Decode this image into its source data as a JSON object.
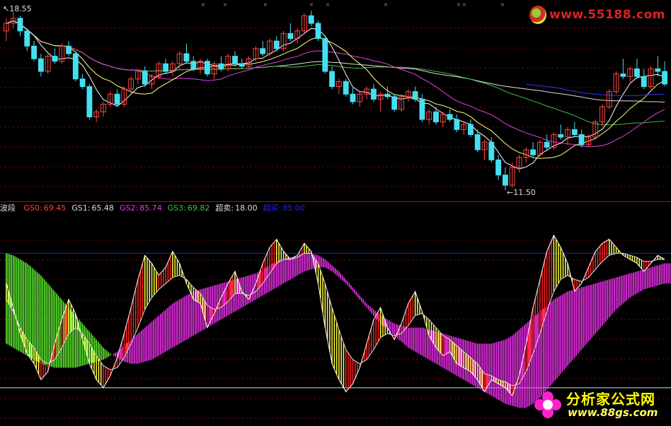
{
  "watermark": {
    "top": "www.55188.com",
    "bottom_title": "分析家公式网",
    "bottom_url": "www.88gs.com"
  },
  "colors": {
    "background": "#000000",
    "up_candle": "#ff4444",
    "down_candle": "#44e0f0",
    "ma_short": "#ffffff",
    "ma_mid": "#ffff80",
    "ma_long1": "#e040e0",
    "ma_long2": "#40c040",
    "ma_long3": "#dddddd",
    "ma_long4": "#3333ff",
    "grid": "#8b0000",
    "divider": "#cc0000",
    "top_marks": "#e040e0"
  },
  "chart_data": {
    "type": "candlestick",
    "price_panel": {
      "high_label": "18.55",
      "low_label": "11.50",
      "ylim": [
        11.2,
        18.8
      ],
      "candles": [
        [
          17.8,
          18.3,
          17.4,
          18.1
        ],
        [
          18.1,
          18.55,
          17.9,
          18.3
        ],
        [
          18.3,
          18.4,
          17.6,
          17.8
        ],
        [
          17.8,
          17.9,
          17.0,
          17.2
        ],
        [
          17.2,
          17.4,
          16.6,
          16.7
        ],
        [
          16.7,
          16.9,
          16.0,
          16.2
        ],
        [
          16.2,
          16.9,
          16.1,
          16.8
        ],
        [
          16.8,
          17.1,
          16.5,
          16.6
        ],
        [
          16.6,
          17.3,
          16.5,
          17.2
        ],
        [
          17.2,
          17.4,
          16.8,
          16.9
        ],
        [
          16.9,
          17.0,
          15.8,
          15.9
        ],
        [
          15.9,
          16.1,
          15.5,
          15.6
        ],
        [
          15.6,
          15.7,
          14.3,
          14.4
        ],
        [
          14.4,
          14.7,
          14.2,
          14.6
        ],
        [
          14.6,
          15.0,
          14.4,
          14.9
        ],
        [
          14.9,
          15.4,
          14.8,
          15.3
        ],
        [
          15.3,
          15.5,
          14.8,
          14.9
        ],
        [
          14.9,
          15.6,
          14.8,
          15.5
        ],
        [
          15.5,
          16.0,
          15.3,
          15.9
        ],
        [
          15.9,
          16.3,
          15.7,
          16.2
        ],
        [
          16.2,
          16.4,
          15.6,
          15.7
        ],
        [
          15.7,
          16.1,
          15.5,
          16.0
        ],
        [
          16.0,
          16.6,
          15.9,
          16.5
        ],
        [
          16.5,
          16.7,
          16.1,
          16.2
        ],
        [
          16.2,
          16.6,
          16.0,
          16.5
        ],
        [
          16.5,
          17.0,
          16.3,
          16.9
        ],
        [
          16.9,
          17.3,
          16.5,
          16.6
        ],
        [
          16.6,
          16.8,
          16.2,
          16.3
        ],
        [
          16.3,
          16.7,
          16.1,
          16.6
        ],
        [
          16.6,
          16.7,
          16.0,
          16.1
        ],
        [
          16.1,
          16.6,
          15.9,
          16.5
        ],
        [
          16.5,
          16.8,
          16.2,
          16.3
        ],
        [
          16.3,
          16.9,
          16.2,
          16.8
        ],
        [
          16.8,
          17.0,
          16.4,
          16.5
        ],
        [
          16.5,
          16.7,
          16.3,
          16.4
        ],
        [
          16.4,
          16.8,
          16.3,
          16.7
        ],
        [
          16.7,
          17.2,
          16.6,
          17.1
        ],
        [
          17.1,
          17.4,
          16.8,
          16.9
        ],
        [
          16.9,
          17.5,
          16.8,
          17.4
        ],
        [
          17.4,
          17.6,
          17.0,
          17.1
        ],
        [
          17.1,
          17.8,
          17.0,
          17.7
        ],
        [
          17.7,
          18.1,
          17.4,
          17.5
        ],
        [
          17.5,
          17.9,
          17.3,
          17.8
        ],
        [
          17.8,
          18.5,
          17.7,
          18.4
        ],
        [
          18.4,
          18.6,
          18.0,
          18.1
        ],
        [
          18.1,
          18.2,
          17.4,
          17.5
        ],
        [
          17.5,
          17.6,
          16.1,
          16.2
        ],
        [
          16.2,
          16.4,
          15.5,
          15.6
        ],
        [
          15.6,
          15.9,
          15.3,
          15.8
        ],
        [
          15.8,
          15.9,
          15.2,
          15.3
        ],
        [
          15.3,
          15.6,
          14.9,
          15.0
        ],
        [
          15.0,
          15.4,
          14.8,
          15.3
        ],
        [
          15.3,
          15.6,
          15.1,
          15.5
        ],
        [
          15.5,
          15.7,
          15.0,
          15.1
        ],
        [
          15.1,
          15.4,
          14.6,
          15.3
        ],
        [
          15.3,
          15.6,
          15.1,
          15.2
        ],
        [
          15.2,
          15.3,
          14.6,
          14.7
        ],
        [
          14.7,
          15.3,
          14.6,
          15.2
        ],
        [
          15.2,
          15.5,
          15.0,
          15.4
        ],
        [
          15.4,
          15.6,
          15.0,
          15.1
        ],
        [
          15.1,
          15.3,
          14.2,
          14.3
        ],
        [
          14.3,
          14.7,
          14.1,
          14.6
        ],
        [
          14.6,
          14.8,
          14.1,
          14.2
        ],
        [
          14.2,
          14.6,
          14.0,
          14.5
        ],
        [
          14.5,
          14.7,
          14.2,
          14.3
        ],
        [
          14.3,
          14.5,
          13.8,
          13.9
        ],
        [
          13.9,
          14.2,
          13.7,
          14.1
        ],
        [
          14.1,
          14.3,
          13.6,
          13.7
        ],
        [
          13.7,
          13.9,
          13.0,
          13.1
        ],
        [
          13.1,
          13.5,
          12.7,
          13.4
        ],
        [
          13.4,
          13.6,
          12.6,
          12.7
        ],
        [
          12.7,
          12.9,
          11.9,
          12.1
        ],
        [
          12.1,
          12.4,
          11.5,
          11.7
        ],
        [
          11.7,
          12.6,
          11.6,
          12.4
        ],
        [
          12.4,
          12.9,
          12.2,
          12.8
        ],
        [
          12.8,
          13.2,
          12.6,
          13.1
        ],
        [
          13.1,
          13.4,
          12.8,
          12.9
        ],
        [
          12.9,
          13.5,
          12.8,
          13.4
        ],
        [
          13.4,
          13.7,
          13.1,
          13.2
        ],
        [
          13.2,
          13.8,
          13.1,
          13.7
        ],
        [
          13.7,
          14.1,
          13.5,
          13.6
        ],
        [
          13.6,
          14.0,
          13.3,
          13.9
        ],
        [
          13.9,
          14.2,
          13.6,
          13.7
        ],
        [
          13.7,
          13.9,
          13.2,
          13.3
        ],
        [
          13.3,
          13.7,
          13.2,
          13.6
        ],
        [
          13.6,
          14.3,
          13.5,
          14.2
        ],
        [
          14.2,
          14.9,
          14.0,
          14.8
        ],
        [
          14.8,
          15.5,
          14.7,
          15.4
        ],
        [
          15.4,
          16.2,
          15.3,
          16.1
        ],
        [
          16.1,
          16.7,
          15.9,
          16.0
        ],
        [
          16.0,
          16.4,
          15.7,
          16.3
        ],
        [
          16.3,
          16.7,
          15.9,
          16.0
        ],
        [
          16.0,
          16.3,
          15.5,
          15.6
        ],
        [
          15.6,
          16.4,
          15.5,
          16.3
        ],
        [
          16.3,
          16.8,
          16.0,
          16.2
        ],
        [
          16.2,
          16.6,
          15.6,
          15.7
        ]
      ]
    },
    "indicator_panel": {
      "name": "波段",
      "items": [
        {
          "key": "GS0",
          "value": "69.45",
          "color": "#ff4040"
        },
        {
          "key": "GS1",
          "value": "65.48",
          "color": "#dddddd"
        },
        {
          "key": "GS2",
          "value": "85.74",
          "color": "#e040e0"
        },
        {
          "key": "GS3",
          "value": "69.82",
          "color": "#40c040"
        },
        {
          "key": "超卖",
          "value": "18.00",
          "color": "#dddddd"
        },
        {
          "key": "超买",
          "value": "85.00",
          "color": "#2020ff"
        }
      ],
      "ylim": [
        0,
        100
      ],
      "overbought": 85,
      "oversold": 18,
      "gs0": [
        70,
        58,
        45,
        35,
        30,
        22,
        26,
        40,
        52,
        62,
        55,
        42,
        30,
        22,
        18,
        24,
        33,
        45,
        58,
        72,
        84,
        80,
        74,
        78,
        86,
        80,
        70,
        62,
        60,
        48,
        55,
        63,
        70,
        76,
        66,
        62,
        70,
        80,
        88,
        92,
        86,
        82,
        84,
        90,
        86,
        70,
        48,
        30,
        22,
        16,
        20,
        28,
        40,
        52,
        58,
        48,
        42,
        50,
        60,
        66,
        56,
        44,
        38,
        34,
        36,
        30,
        28,
        26,
        22,
        16,
        22,
        20,
        18,
        14,
        24,
        40,
        58,
        72,
        86,
        94,
        88,
        80,
        66,
        70,
        78,
        86,
        90,
        92,
        88,
        84,
        82,
        80,
        76,
        80,
        84,
        82
      ],
      "gs1": [
        62,
        56,
        48,
        42,
        38,
        32,
        30,
        32,
        38,
        45,
        48,
        45,
        40,
        34,
        29,
        27,
        28,
        33,
        40,
        48,
        57,
        63,
        67,
        70,
        73,
        74,
        72,
        68,
        65,
        59,
        57,
        58,
        61,
        65,
        65,
        64,
        66,
        70,
        75,
        80,
        82,
        82,
        83,
        85,
        85,
        80,
        70,
        58,
        47,
        37,
        32,
        30,
        32,
        37,
        43,
        45,
        44,
        45,
        49,
        54,
        55,
        52,
        48,
        44,
        42,
        39,
        36,
        33,
        30,
        25,
        24,
        22,
        21,
        19,
        20,
        26,
        35,
        45,
        56,
        66,
        72,
        74,
        72,
        71,
        73,
        77,
        81,
        84,
        85,
        85,
        84,
        83,
        81,
        81,
        82,
        82
      ],
      "gs2": [
        40,
        38,
        36,
        34,
        32,
        30,
        29,
        28,
        28,
        28,
        28,
        29,
        30,
        31,
        32,
        34,
        36,
        39,
        42,
        45,
        48,
        51,
        54,
        57,
        60,
        62,
        64,
        66,
        67,
        68,
        69,
        70,
        71,
        72,
        73,
        74,
        75,
        77,
        79,
        81,
        82,
        83,
        84,
        85,
        85,
        84,
        82,
        79,
        76,
        72,
        68,
        64,
        60,
        57,
        54,
        52,
        50,
        49,
        48,
        48,
        48,
        47,
        46,
        45,
        44,
        43,
        42,
        41,
        40,
        40,
        40,
        41,
        42,
        44,
        47,
        50,
        53,
        56,
        59,
        62,
        64,
        66,
        67,
        68,
        69,
        70,
        71,
        72,
        73,
        74,
        75,
        76,
        77,
        78,
        79,
        80
      ],
      "gs3": [
        85,
        84,
        82,
        80,
        77,
        74,
        70,
        66,
        62,
        58,
        54,
        50,
        46,
        42,
        38,
        35,
        33,
        31,
        30,
        30,
        31,
        32,
        34,
        36,
        38,
        40,
        42,
        44,
        46,
        48,
        50,
        52,
        54,
        56,
        58,
        60,
        62,
        64,
        66,
        68,
        70,
        72,
        74,
        76,
        77,
        78,
        78,
        76,
        73,
        70,
        66,
        62,
        58,
        54,
        50,
        47,
        44,
        41,
        38,
        36,
        34,
        32,
        30,
        28,
        26,
        24,
        22,
        20,
        18,
        16,
        14,
        12,
        10,
        9,
        8,
        8,
        10,
        13,
        17,
        21,
        25,
        29,
        33,
        37,
        41,
        45,
        49,
        53,
        57,
        60,
        63,
        65,
        67,
        68,
        69,
        70
      ]
    }
  }
}
